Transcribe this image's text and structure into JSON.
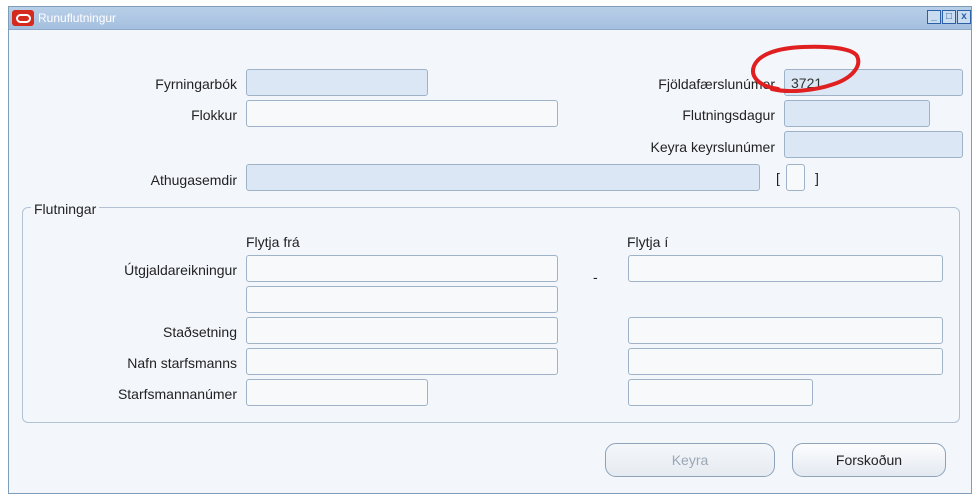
{
  "window": {
    "title": "Runuflutningur",
    "controls": {
      "minimize": "_",
      "maximize": "□",
      "close": "x"
    }
  },
  "header_form": {
    "asset_book_label": "Fyrningarbók",
    "asset_book_value": "",
    "category_label": "Flokkur",
    "category_value": "",
    "comments_label": "Athugasemdir",
    "comments_value": "",
    "mass_transfer_number_label": "Fjöldafærslunúmer",
    "mass_transfer_number_value": "3721",
    "transfer_date_label": "Flutningsdagur",
    "transfer_date_value": "",
    "run_request_number_label": "Keyra keyrslunúmer",
    "run_request_number_value": "",
    "dff_bracket_open": "[",
    "dff_bracket_close": "]"
  },
  "transfers": {
    "legend": "Flutningar",
    "from_header": "Flytja frá",
    "to_header": "Flytja í",
    "expense_account_label": "Útgjaldareikningur",
    "separator": "-",
    "location_label": "Staðsetning",
    "employee_name_label": "Nafn starfsmanns",
    "employee_number_label": "Starfsmannanúmer",
    "values": {
      "from_expense_account": "",
      "from_expense_account_2": "",
      "to_expense_account": "",
      "from_location": "",
      "to_location": "",
      "from_employee_name": "",
      "to_employee_name": "",
      "from_employee_number": "",
      "to_employee_number": ""
    }
  },
  "buttons": {
    "run": "Keyra",
    "preview": "Forskoðun"
  },
  "colors": {
    "annotation_circle": "#e02020",
    "required_field": "#dbe7f5",
    "titlebar": "#a4bfdf",
    "oracle_icon": "#d52b1e"
  }
}
